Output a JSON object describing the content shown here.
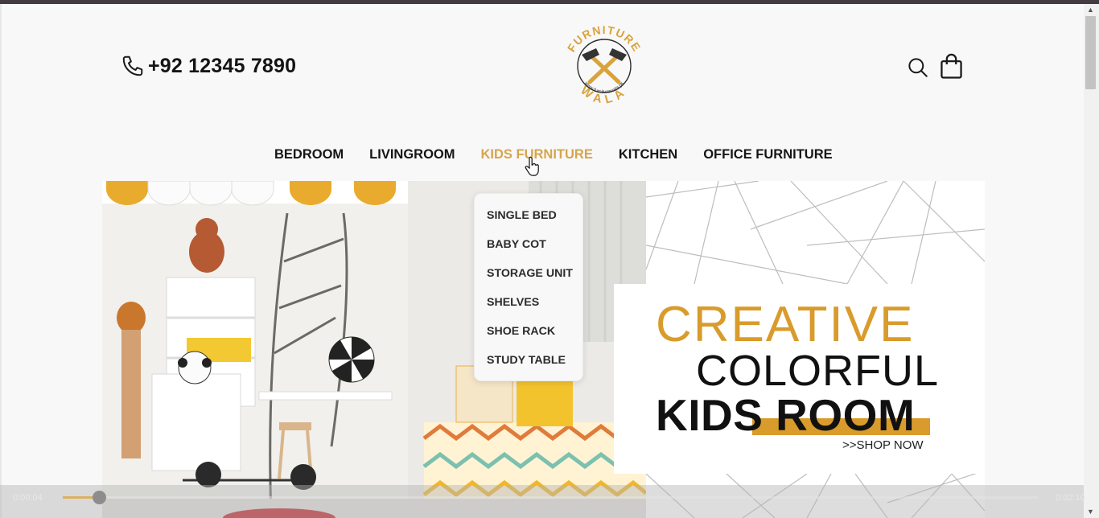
{
  "header": {
    "phone": "+92 12345 7890",
    "logo": {
      "top_text": "FURNITURE",
      "bottom_text": "WALA",
      "url_text": "www.furniturewala.pk"
    }
  },
  "icons": {
    "phone": "phone-icon",
    "search": "search-icon",
    "cart": "shopping-bag-icon"
  },
  "nav": {
    "items": [
      {
        "label": "BEDROOM"
      },
      {
        "label": "LIVINGROOM"
      },
      {
        "label": "KIDS FURNITURE",
        "active": true
      },
      {
        "label": "KITCHEN"
      },
      {
        "label": "OFFICE FURNITURE"
      }
    ]
  },
  "dropdown": {
    "items": [
      "SINGLE BED",
      "BABY COT",
      "STORAGE UNIT",
      "SHELVES",
      "SHOE RACK",
      "STUDY TABLE"
    ]
  },
  "promo": {
    "line1": "CREATIVE",
    "line2": "COLORFUL",
    "line3": "KIDS ROOM",
    "cta": ">>SHOP NOW"
  },
  "video": {
    "current_time": "0:00:04",
    "duration": "0:02:10"
  },
  "colors": {
    "accent": "#d99b2b",
    "nav_active": "#d6a54b",
    "text": "#151515"
  }
}
